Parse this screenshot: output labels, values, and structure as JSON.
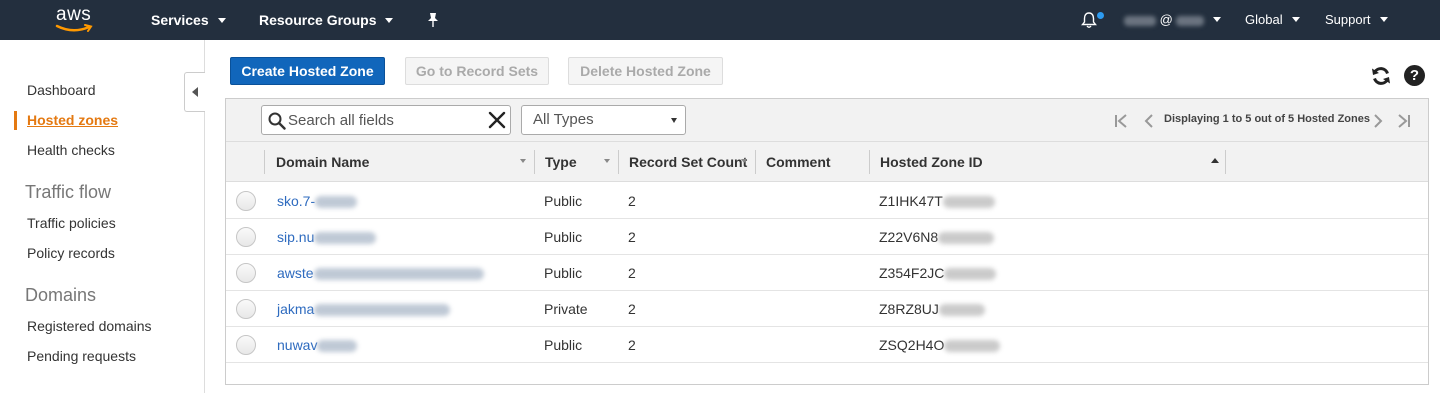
{
  "topnav": {
    "logo_text": "aws",
    "services": "Services",
    "resource_groups": "Resource Groups",
    "user_at": "@",
    "region": "Global",
    "support": "Support"
  },
  "sidebar": {
    "items": [
      {
        "label": "Dashboard"
      },
      {
        "label": "Hosted zones"
      },
      {
        "label": "Health checks"
      }
    ],
    "sections": [
      {
        "heading": "Traffic flow",
        "items": [
          {
            "label": "Traffic policies"
          },
          {
            "label": "Policy records"
          }
        ]
      },
      {
        "heading": "Domains",
        "items": [
          {
            "label": "Registered domains"
          },
          {
            "label": "Pending requests"
          }
        ]
      }
    ]
  },
  "actions": {
    "create": "Create Hosted Zone",
    "goto": "Go to Record Sets",
    "delete": "Delete Hosted Zone"
  },
  "filter": {
    "search_placeholder": "Search all fields",
    "type_selected": "All Types"
  },
  "pager": {
    "text": "Displaying 1 to 5 out of 5 Hosted Zones"
  },
  "table": {
    "columns": [
      "Domain Name",
      "Type",
      "Record Set Count",
      "Comment",
      "Hosted Zone ID"
    ],
    "rows": [
      {
        "domain": "sko.7-",
        "type": "Public",
        "count": "2",
        "comment": "",
        "zone_id": "Z1IHK47T"
      },
      {
        "domain": "sip.nu",
        "type": "Public",
        "count": "2",
        "comment": "",
        "zone_id": "Z22V6N8"
      },
      {
        "domain": "awste",
        "type": "Public",
        "count": "2",
        "comment": "",
        "zone_id": "Z354F2JC"
      },
      {
        "domain": "jakma",
        "type": "Private",
        "count": "2",
        "comment": "",
        "zone_id": "Z8RZ8UJ"
      },
      {
        "domain": "nuwav",
        "type": "Public",
        "count": "2",
        "comment": "",
        "zone_id": "ZSQ2H4O"
      }
    ]
  }
}
